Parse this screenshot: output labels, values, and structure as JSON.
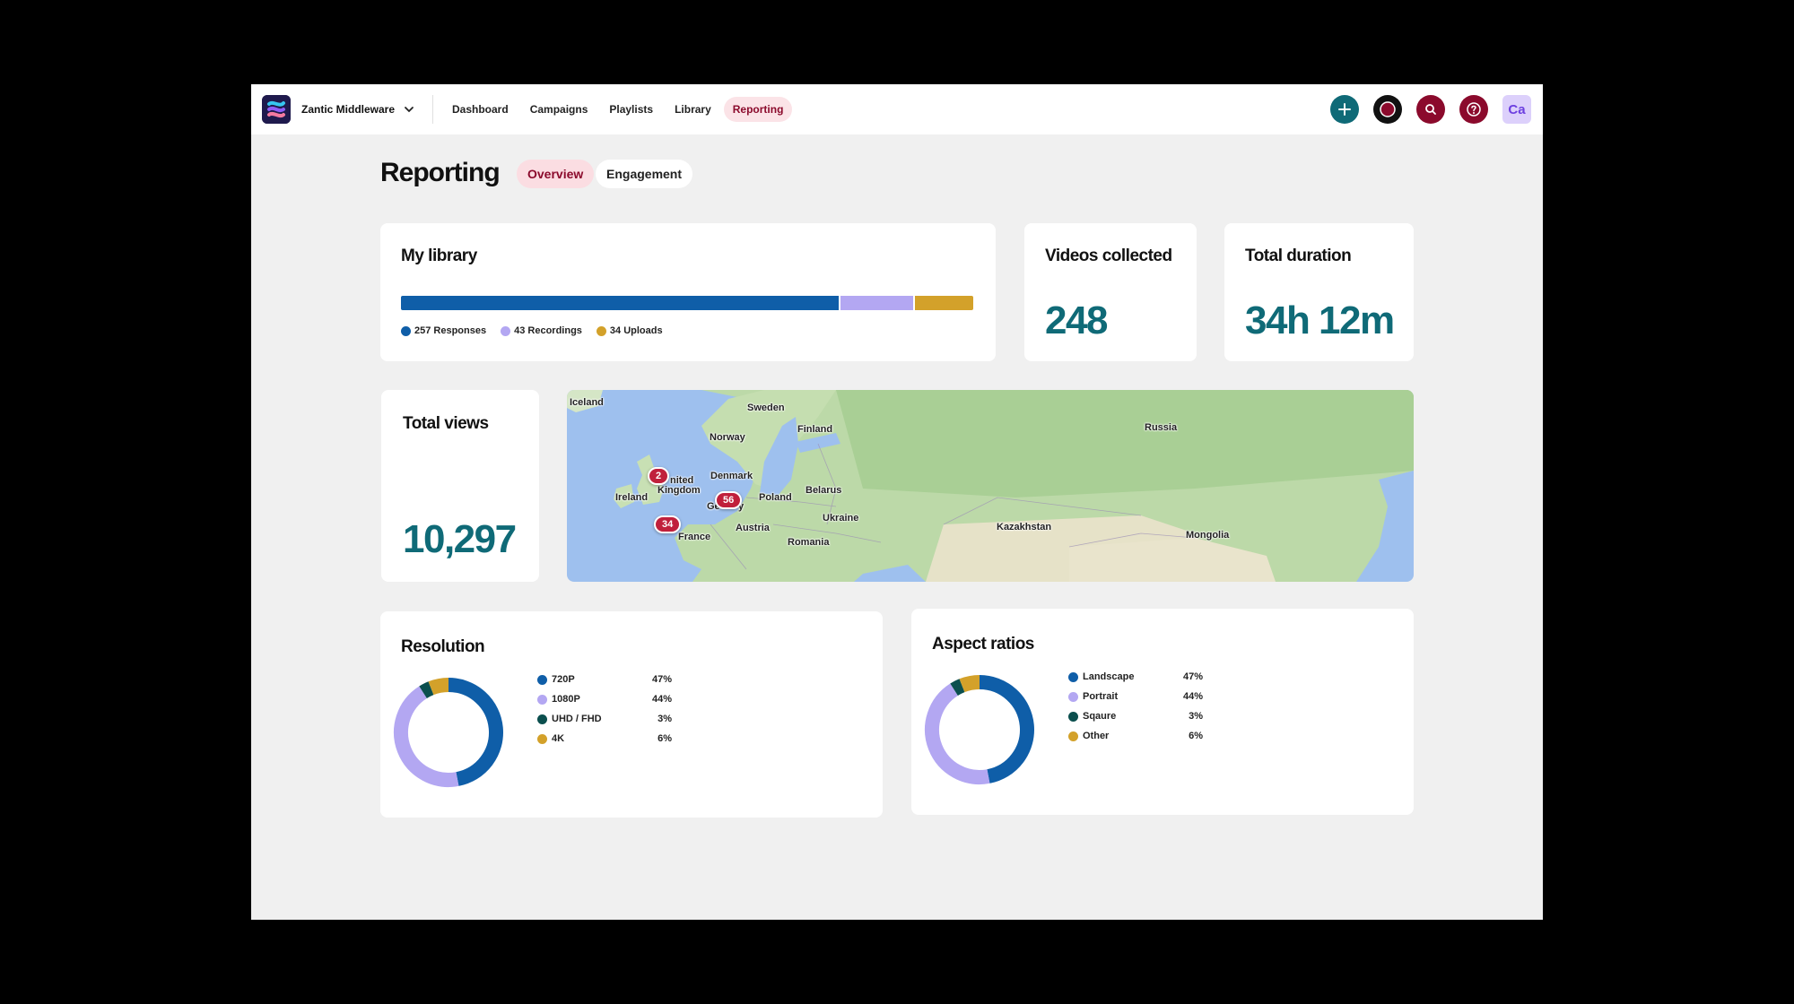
{
  "header": {
    "org_name": "Zantic Middleware",
    "nav": [
      {
        "label": "Dashboard",
        "active": false
      },
      {
        "label": "Campaigns",
        "active": false
      },
      {
        "label": "Playlists",
        "active": false
      },
      {
        "label": "Library",
        "active": false
      },
      {
        "label": "Reporting",
        "active": true
      }
    ],
    "icons": [
      "plus-icon",
      "profile-circle-icon",
      "search-icon",
      "help-icon"
    ],
    "avatar_initials": "Ca"
  },
  "page": {
    "title": "Reporting",
    "tabs": [
      {
        "label": "Overview",
        "active": true
      },
      {
        "label": "Engagement",
        "active": false
      }
    ]
  },
  "library": {
    "title": "My library",
    "segments": [
      {
        "label": "257 Responses",
        "value": 257,
        "color": "#0f5ea8"
      },
      {
        "label": "43 Recordings",
        "value": 43,
        "color": "#b3a7f2"
      },
      {
        "label": "34 Uploads",
        "value": 34,
        "color": "#d3a12a"
      }
    ]
  },
  "videos_collected": {
    "title": "Videos collected",
    "value": "248"
  },
  "total_duration": {
    "title": "Total duration",
    "value": "34h 12m"
  },
  "total_views": {
    "title": "Total views",
    "value": "10,297"
  },
  "map": {
    "labels": [
      "Iceland",
      "Sweden",
      "Finland",
      "Norway",
      "Russia",
      "nited",
      "Kingdom",
      "Denmark",
      "Ireland",
      "Belarus",
      "Ge",
      "y",
      "Poland",
      "Ukraine",
      "Austria",
      "Kazakhstan",
      "France",
      "Romania",
      "Mongolia"
    ],
    "markers": [
      "2",
      "56",
      "34"
    ]
  },
  "resolution": {
    "title": "Resolution",
    "rows": [
      {
        "label": "720P",
        "pct": "47%",
        "value": 47,
        "color": "#0f5ea8"
      },
      {
        "label": "1080P",
        "pct": "44%",
        "value": 44,
        "color": "#b3a7f2"
      },
      {
        "label": "UHD / FHD",
        "pct": "3%",
        "value": 3,
        "color": "#0b4f4e"
      },
      {
        "label": "4K",
        "pct": "6%",
        "value": 6,
        "color": "#d3a12a"
      }
    ]
  },
  "aspect": {
    "title": "Aspect ratios",
    "rows": [
      {
        "label": "Landscape",
        "pct": "47%",
        "value": 47,
        "color": "#0f5ea8"
      },
      {
        "label": "Portrait",
        "pct": "44%",
        "value": 44,
        "color": "#b3a7f2"
      },
      {
        "label": "Sqaure",
        "pct": "3%",
        "value": 3,
        "color": "#0b4f4e"
      },
      {
        "label": "Other",
        "pct": "6%",
        "value": 6,
        "color": "#d3a12a"
      }
    ]
  }
}
